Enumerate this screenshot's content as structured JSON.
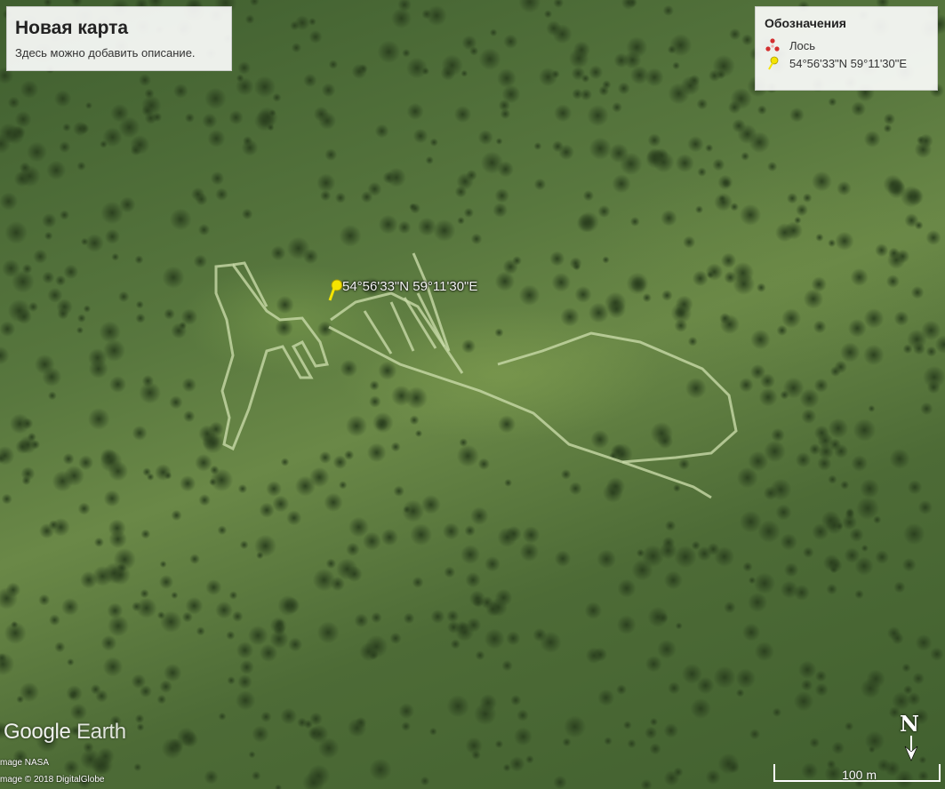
{
  "title_panel": {
    "title": "Новая карта",
    "description": "Здесь можно добавить описание."
  },
  "legend": {
    "title": "Обозначения",
    "items": [
      {
        "label": "Лось",
        "icon": "moose-path-icon",
        "color": "#d32f2f"
      },
      {
        "label": "54°56'33\"N 59°11'30\"E",
        "icon": "yellow-pushpin-icon",
        "color": "#f5e400"
      }
    ]
  },
  "placemark": {
    "label": "54°56'33\"N 59°11'30\"E",
    "icon": "yellow-pushpin-icon",
    "color": "#f5e400"
  },
  "branding": {
    "logo_google": "Google",
    "logo_earth": "Earth",
    "credit_1": "mage NASA",
    "credit_2": "mage © 2018 DigitalGlobe"
  },
  "compass": {
    "label": "N",
    "icon": "north-arrow-icon"
  },
  "scale": {
    "label": "100 m"
  },
  "colors": {
    "geoglyph_line": "#c8d9a8"
  }
}
